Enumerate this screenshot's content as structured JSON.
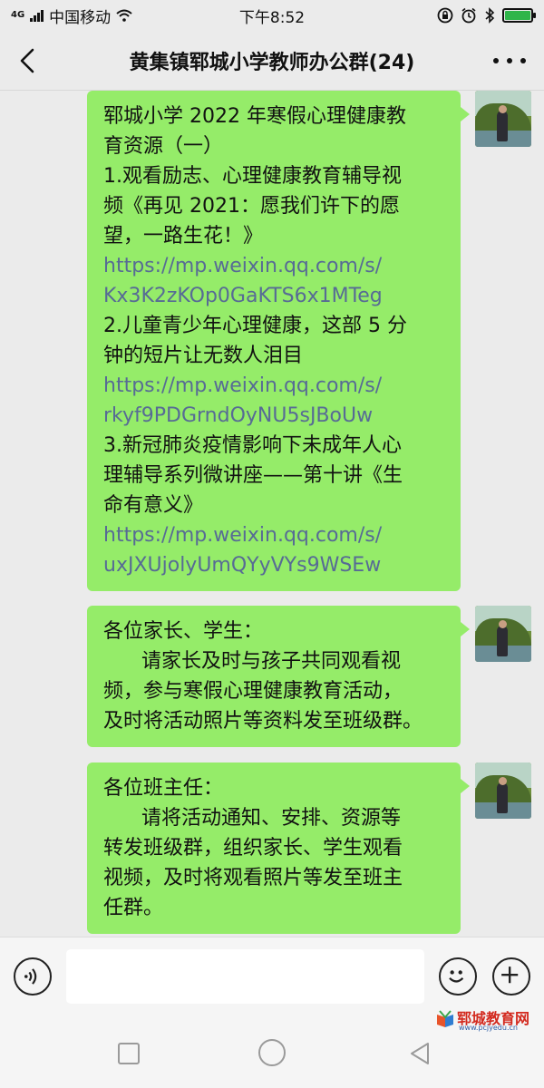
{
  "status_bar": {
    "network_tag": "4G",
    "carrier": "中国移动",
    "time": "下午8:52",
    "battery_level": 1.0,
    "icons": [
      "signal-icon",
      "wifi-icon",
      "lock-rotation-icon",
      "alarm-icon",
      "bluetooth-icon",
      "battery-charging-icon"
    ]
  },
  "header": {
    "title": "黄集镇郓城小学教师办公群(24)",
    "back_icon": "back-chevron-icon",
    "more_icon": "more-dots-icon"
  },
  "messages": [
    {
      "sender": "self",
      "lines": [
        {
          "text": "郓城小学 2022 年寒假心理健康教",
          "link": false
        },
        {
          "text": "育资源（一）",
          "link": false
        },
        {
          "text": "1.观看励志、心理健康教育辅导视",
          "link": false
        },
        {
          "text": "频《再见 2021：愿我们许下的愿",
          "link": false
        },
        {
          "text": "望，一路生花！》",
          "link": false
        },
        {
          "text": "https://mp.weixin.qq.com/s/",
          "link": true
        },
        {
          "text": "Kx3K2zKOp0GaKTS6x1MTeg",
          "link": true
        },
        {
          "text": "2.儿童青少年心理健康，这部 5 分",
          "link": false
        },
        {
          "text": "钟的短片让无数人泪目",
          "link": false
        },
        {
          "text": "https://mp.weixin.qq.com/s/",
          "link": true
        },
        {
          "text": "rkyf9PDGrndOyNU5sJBoUw",
          "link": true
        },
        {
          "text": "3.新冠肺炎疫情影响下未成年人心",
          "link": false
        },
        {
          "text": "理辅导系列微讲座——第十讲《生",
          "link": false
        },
        {
          "text": "命有意义》",
          "link": false
        },
        {
          "text": "https://mp.weixin.qq.com/s/",
          "link": true
        },
        {
          "text": "uxJXUjolyUmQYyVYs9WSEw",
          "link": true
        }
      ]
    },
    {
      "sender": "self",
      "lines": [
        {
          "text": "各位家长、学生：",
          "link": false
        },
        {
          "text": "      请家长及时与孩子共同观看视",
          "link": false
        },
        {
          "text": "频，参与寒假心理健康教育活动，",
          "link": false
        },
        {
          "text": "及时将活动照片等资料发至班级群。",
          "link": false
        }
      ]
    },
    {
      "sender": "self",
      "lines": [
        {
          "text": "各位班主任：",
          "link": false
        },
        {
          "text": "      请将活动通知、安排、资源等",
          "link": false
        },
        {
          "text": "转发班级群，组织家长、学生观看",
          "link": false
        },
        {
          "text": "视频，及时将观看照片等发至班主",
          "link": false
        },
        {
          "text": "任群。",
          "link": false
        }
      ]
    }
  ],
  "input_bar": {
    "value": "",
    "voice_icon": "voice-icon",
    "emoji_icon": "emoji-icon",
    "plus_icon": "plus-icon"
  },
  "watermark": {
    "title": "郓城教育网",
    "url": "www.pcjyedu.cn"
  },
  "colors": {
    "bubble": "#95ec69",
    "link": "#576b95",
    "background": "#ebebeb"
  }
}
